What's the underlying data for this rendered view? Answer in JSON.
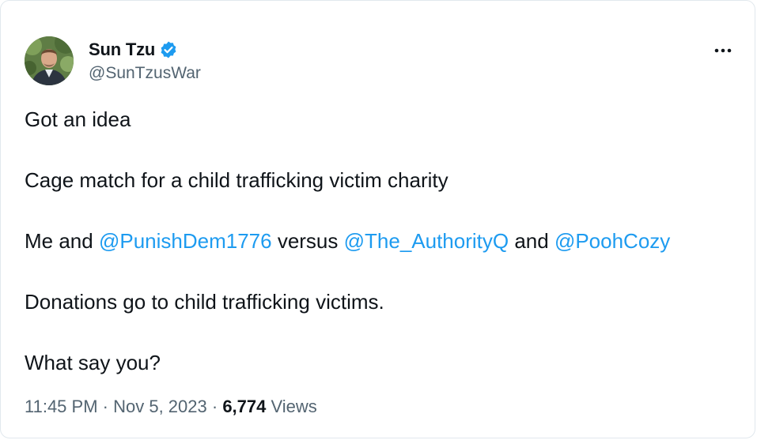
{
  "author": {
    "display_name": "Sun Tzu",
    "handle": "@SunTzusWar",
    "verified": true,
    "avatar_icon": "profile-photo"
  },
  "menu_icon": "more-horizontal-icon",
  "tweet": {
    "line1": "Got an idea",
    "line2": "Cage match for a child trafficking victim charity",
    "line3": {
      "prefix": "Me and ",
      "mention1": "@PunishDem1776",
      "mid1": " versus ",
      "mention2": "@The_AuthorityQ",
      "mid2": " and ",
      "mention3": "@PoohCozy"
    },
    "line4": "Donations go to child trafficking victims.",
    "line5": "What say you?"
  },
  "meta": {
    "time": "11:45 PM",
    "separator1": " · ",
    "date": "Nov 5, 2023",
    "separator2": " · ",
    "views_count": "6,774",
    "views_label": " Views"
  },
  "colors": {
    "link": "#1d9bf0",
    "text": "#0f1419",
    "secondary": "#536471",
    "verified": "#1d9bf0"
  }
}
